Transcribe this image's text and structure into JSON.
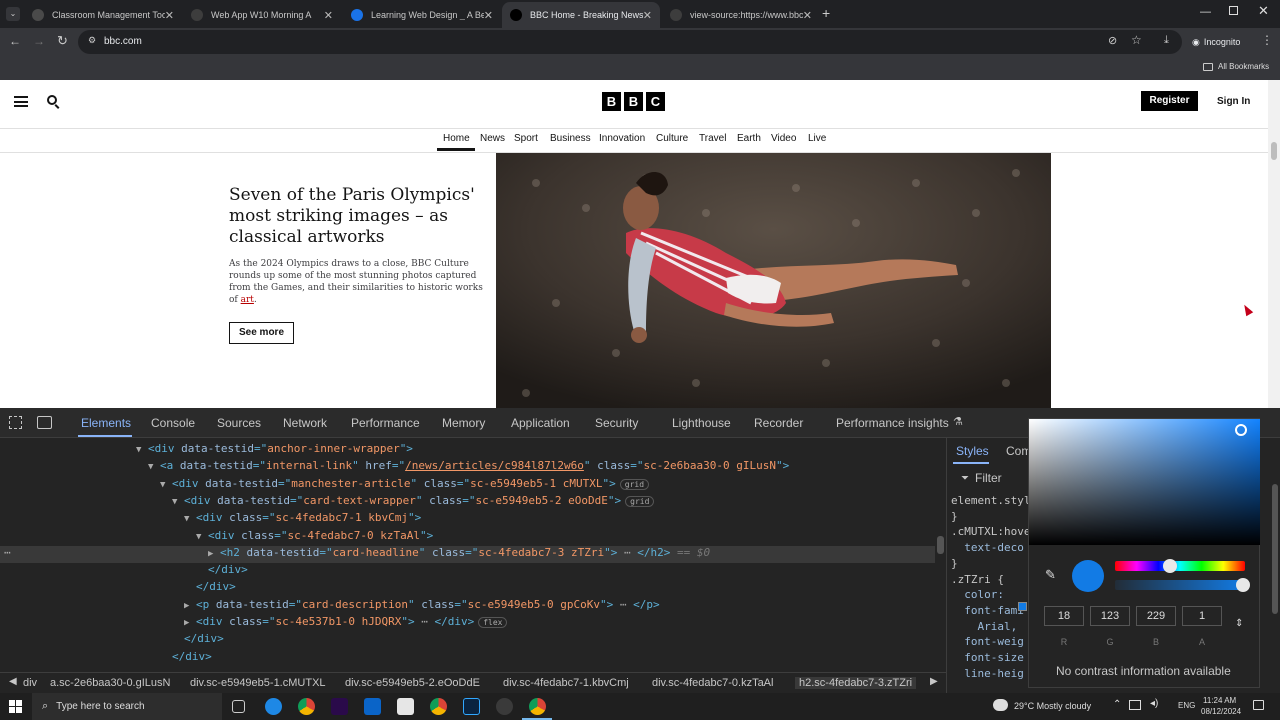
{
  "browser": {
    "tabs": [
      {
        "label": "Classroom Management Tools",
        "icon_color": "#4a4a4a"
      },
      {
        "label": "Web App W10 Morning A",
        "icon_color": "#3d3d3d"
      },
      {
        "label": "Learning Web Design _ A Begin",
        "icon_color": "#1a73e8"
      },
      {
        "label": "BBC Home - Breaking News, W",
        "icon_color": "#000000"
      },
      {
        "label": "view-source:https://www.bbc.c",
        "icon_color": "#3d3d3d"
      }
    ],
    "url": "bbc.com",
    "incognito_label": "Incognito",
    "all_bookmarks": "All Bookmarks"
  },
  "page": {
    "logo_letters": [
      "B",
      "B",
      "C"
    ],
    "register_label": "Register",
    "signin_label": "Sign In",
    "nav": [
      "Home",
      "News",
      "Sport",
      "Business",
      "Innovation",
      "Culture",
      "Travel",
      "Earth",
      "Video",
      "Live"
    ],
    "headline": "Seven of the Paris Olympics' most striking images – as classical artworks",
    "description": "As the 2024 Olympics draws to a close, BBC Culture rounds up some of the most stunning photos captured from the Games, and their similarities to historic works of ",
    "description_link": "art",
    "description_end": ".",
    "see_more": "See more"
  },
  "devtools": {
    "tabs": [
      "Elements",
      "Console",
      "Sources",
      "Network",
      "Performance",
      "Memory",
      "Application",
      "Security",
      "Lighthouse",
      "Recorder",
      "Performance insights"
    ],
    "dom_lines": [
      {
        "indent": 0,
        "toggle": "▼",
        "parts": [
          [
            "tag",
            "<div "
          ],
          [
            "attr",
            "data-testid"
          ],
          [
            "tag",
            "=\""
          ],
          [
            "val",
            "anchor-inner-wrapper"
          ],
          [
            "tag",
            "\">"
          ]
        ]
      },
      {
        "indent": 1,
        "toggle": "▼",
        "parts": [
          [
            "tag",
            "<a "
          ],
          [
            "attr",
            "data-testid"
          ],
          [
            "tag",
            "=\""
          ],
          [
            "val",
            "internal-link"
          ],
          [
            "tag",
            "\" "
          ],
          [
            "attr",
            "href"
          ],
          [
            "tag",
            "=\""
          ],
          [
            "link",
            "/news/articles/c984l87l2w6o"
          ],
          [
            "tag",
            "\" "
          ],
          [
            "attr",
            "class"
          ],
          [
            "tag",
            "=\""
          ],
          [
            "val",
            "sc-2e6baa30-0 gILusN"
          ],
          [
            "tag",
            "\">"
          ]
        ]
      },
      {
        "indent": 2,
        "toggle": "▼",
        "parts": [
          [
            "tag",
            "<div "
          ],
          [
            "attr",
            "data-testid"
          ],
          [
            "tag",
            "=\""
          ],
          [
            "val",
            "manchester-article"
          ],
          [
            "tag",
            "\" "
          ],
          [
            "attr",
            "class"
          ],
          [
            "tag",
            "=\""
          ],
          [
            "val",
            "sc-e5949eb5-1 cMUTXL"
          ],
          [
            "tag",
            "\">"
          ]
        ],
        "pill": "grid"
      },
      {
        "indent": 3,
        "toggle": "▼",
        "parts": [
          [
            "tag",
            "<div "
          ],
          [
            "attr",
            "data-testid"
          ],
          [
            "tag",
            "=\""
          ],
          [
            "val",
            "card-text-wrapper"
          ],
          [
            "tag",
            "\" "
          ],
          [
            "attr",
            "class"
          ],
          [
            "tag",
            "=\""
          ],
          [
            "val",
            "sc-e5949eb5-2 eOoDdE"
          ],
          [
            "tag",
            "\">"
          ]
        ],
        "pill": "grid"
      },
      {
        "indent": 4,
        "toggle": "▼",
        "parts": [
          [
            "tag",
            "<div "
          ],
          [
            "attr",
            "class"
          ],
          [
            "tag",
            "=\""
          ],
          [
            "val",
            "sc-4fedabc7-1 kbvCmj"
          ],
          [
            "tag",
            "\">"
          ]
        ]
      },
      {
        "indent": 5,
        "toggle": "▼",
        "parts": [
          [
            "tag",
            "<div "
          ],
          [
            "attr",
            "class"
          ],
          [
            "tag",
            "=\""
          ],
          [
            "val",
            "sc-4fedabc7-0 kzTaAl"
          ],
          [
            "tag",
            "\">"
          ]
        ]
      },
      {
        "indent": 6,
        "toggle": "▶",
        "parts": [
          [
            "tag",
            "<h2 "
          ],
          [
            "attr",
            "data-testid"
          ],
          [
            "tag",
            "=\""
          ],
          [
            "val",
            "card-headline"
          ],
          [
            "tag",
            "\" "
          ],
          [
            "attr",
            "class"
          ],
          [
            "tag",
            "=\""
          ],
          [
            "val",
            "sc-4fedabc7-3 zTZri"
          ],
          [
            "tag",
            "\"> "
          ],
          [
            "plain",
            "⋯"
          ],
          [
            "tag",
            " </h2>"
          ],
          [
            "plain",
            " == $0"
          ]
        ],
        "selected": true
      },
      {
        "indent": 5,
        "toggle": "",
        "parts": [
          [
            "tag",
            "</div>"
          ]
        ]
      },
      {
        "indent": 4,
        "toggle": "",
        "parts": [
          [
            "tag",
            "</div>"
          ]
        ]
      },
      {
        "indent": 4,
        "toggle": "▶",
        "parts": [
          [
            "tag",
            "<p "
          ],
          [
            "attr",
            "data-testid"
          ],
          [
            "tag",
            "=\""
          ],
          [
            "val",
            "card-description"
          ],
          [
            "tag",
            "\" "
          ],
          [
            "attr",
            "class"
          ],
          [
            "tag",
            "=\""
          ],
          [
            "val",
            "sc-e5949eb5-0 gpCoKv"
          ],
          [
            "tag",
            "\"> "
          ],
          [
            "plain",
            "⋯"
          ],
          [
            "tag",
            " </p>"
          ]
        ]
      },
      {
        "indent": 4,
        "toggle": "▶",
        "parts": [
          [
            "tag",
            "<div "
          ],
          [
            "attr",
            "class"
          ],
          [
            "tag",
            "=\""
          ],
          [
            "val",
            "sc-4e537b1-0 hJDQRX"
          ],
          [
            "tag",
            "\"> "
          ],
          [
            "plain",
            "⋯"
          ],
          [
            "tag",
            " </div>"
          ]
        ],
        "pill": "flex"
      },
      {
        "indent": 3,
        "toggle": "",
        "parts": [
          [
            "tag",
            "</div>"
          ]
        ]
      },
      {
        "indent": 2,
        "toggle": "",
        "parts": [
          [
            "tag",
            "</div>"
          ]
        ]
      }
    ],
    "breadcrumbs": [
      "div",
      "a.sc-2e6baa30-0.gILusN",
      "div.sc-e5949eb5-1.cMUTXL",
      "div.sc-e5949eb5-2.eOoDdE",
      "div.sc-4fedabc7-1.kbvCmj",
      "div.sc-4fedabc7-0.kzTaAl",
      "h2.sc-4fedabc7-3.zTZri"
    ],
    "styles_tabs": [
      "Styles",
      "Com"
    ],
    "filter_placeholder": "Filter",
    "style_lines": [
      "element.styl",
      "}",
      ".cMUTXL:hove",
      "  text-deco",
      "}",
      ".zTZri {",
      "  color: ",
      "  font-fami",
      "    Arial,",
      "  font-weig",
      "  font-size",
      "  line-heig"
    ]
  },
  "color_picker": {
    "r": "18",
    "g": "123",
    "b": "229",
    "a": "1",
    "labels": [
      "R",
      "G",
      "B",
      "A"
    ],
    "swatch_color": "#127be5",
    "contrast_text": "No contrast information available"
  },
  "taskbar": {
    "search_placeholder": "Type here to search",
    "weather": "29°C  Mostly cloudy",
    "lang": "ENG",
    "time": "11:24 AM",
    "date": "08/12/2024"
  }
}
